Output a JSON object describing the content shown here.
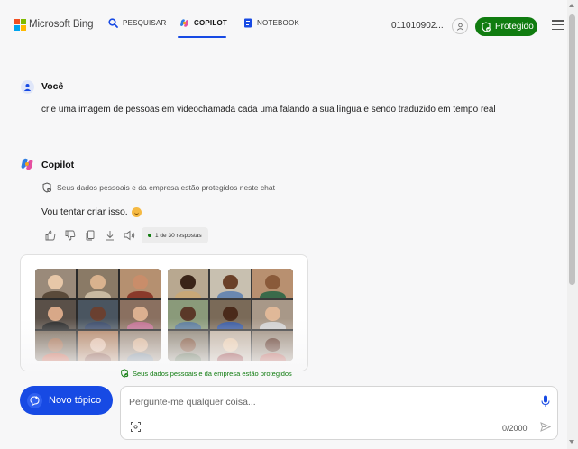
{
  "header": {
    "brand": "Microsoft Bing",
    "tabs": [
      {
        "label": "PESQUISAR",
        "icon": "search-icon",
        "active": false
      },
      {
        "label": "COPILOT",
        "icon": "copilot-icon",
        "active": true
      },
      {
        "label": "NOTEBOOK",
        "icon": "notebook-icon",
        "active": false
      }
    ],
    "account_id": "011010902...",
    "protected_label": "Protegido"
  },
  "chat": {
    "user": {
      "name": "Você",
      "message": "crie uma imagem de pessoas em videochamada cada uma falando a sua língua e sendo traduzido em tempo real"
    },
    "copilot": {
      "name": "Copilot",
      "privacy_note": "Seus dados pessoais e da empresa estão protegidos neste chat",
      "reply": "Vou tentar criar isso.",
      "response_count": "1 de 30 respostas",
      "actions": [
        "thumbs-up-icon",
        "thumbs-down-icon",
        "copy-icon",
        "download-icon",
        "speaker-icon"
      ]
    }
  },
  "composer": {
    "privacy_note": "Seus dados pessoais e da empresa estão protegidos",
    "new_topic_label": "Novo tópico",
    "placeholder": "Pergunte-me qualquer coisa...",
    "char_count": "0/2000"
  },
  "colors": {
    "accent": "#174ae4",
    "protected_green": "#107c10",
    "background": "#f7f7f8"
  }
}
